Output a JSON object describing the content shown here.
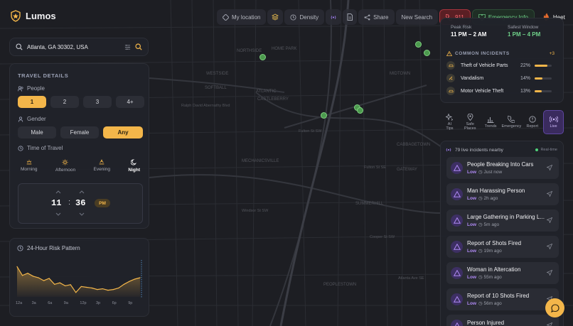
{
  "app": {
    "name": "Lumos"
  },
  "topbar": {
    "my_location": "My location",
    "density": "Density",
    "share": "Share",
    "new_search": "New Search",
    "sos": "911",
    "emergency": "Emergency Info",
    "user": "Heet"
  },
  "search": {
    "value": "Atlanta, GA 30302, USA"
  },
  "travel": {
    "title": "TRAVEL DETAILS",
    "people_label": "People",
    "people_options": [
      "1",
      "2",
      "3",
      "4+"
    ],
    "people_selected": "1",
    "gender_label": "Gender",
    "gender_options": [
      "Male",
      "Female",
      "Any"
    ],
    "gender_selected": "Any",
    "time_label": "Time of Travel",
    "time_options": [
      "Morning",
      "Afternoon",
      "Evening",
      "Night"
    ],
    "time_selected": "Night",
    "hour": "11",
    "sep": ":",
    "minute": "36",
    "ampm": "PM"
  },
  "risk_chart": {
    "title": "24-Hour Risk Pattern",
    "chart_data": {
      "type": "area",
      "title": "24-Hour Risk Pattern",
      "categories": [
        "12a",
        "3a",
        "6a",
        "9a",
        "12p",
        "3p",
        "6p",
        "9p"
      ],
      "x": [
        0,
        1,
        2,
        3,
        4,
        5,
        6,
        7,
        8,
        9,
        10,
        11,
        12,
        13,
        14,
        15,
        16,
        17,
        18,
        19,
        20,
        21,
        22,
        23
      ],
      "values": [
        82,
        58,
        64,
        56,
        52,
        44,
        50,
        34,
        38,
        30,
        33,
        12,
        28,
        26,
        24,
        20,
        22,
        18,
        20,
        24,
        34,
        42,
        48,
        52
      ],
      "ylim": [
        0,
        100
      ],
      "grid": false
    }
  },
  "summary": {
    "peak_label": "Peak Risk",
    "peak_value": "11 PM – 2 AM",
    "safe_label": "Safest Window",
    "safe_value": "1 PM – 4 PM"
  },
  "incidents": {
    "title": "COMMON INCIDENTS",
    "more": "+3",
    "items": [
      {
        "label": "Theft of Vehicle Parts",
        "pct": "22%",
        "value": 0.22
      },
      {
        "label": "Vandalism",
        "pct": "14%",
        "value": 0.14
      },
      {
        "label": "Motor Vehicle Theft",
        "pct": "13%",
        "value": 0.13
      }
    ]
  },
  "tabs": [
    {
      "label1": "AI",
      "label2": "Tips",
      "icon": "sparkle-icon"
    },
    {
      "label1": "Safe",
      "label2": "Places",
      "icon": "map-pin-icon"
    },
    {
      "label1": "Trends",
      "label2": "",
      "icon": "bar-chart-icon"
    },
    {
      "label1": "Emergency",
      "label2": "",
      "icon": "phone-icon"
    },
    {
      "label1": "Report",
      "label2": "",
      "icon": "alert-circle-icon"
    },
    {
      "label1": "Live",
      "label2": "",
      "icon": "broadcast-icon"
    }
  ],
  "feed": {
    "count_text": "79 live incidents nearby",
    "realtime": "Real-time",
    "items": [
      {
        "title": "People Breaking Into Cars",
        "level": "Low",
        "time": "Just now"
      },
      {
        "title": "Man Harassing Person",
        "level": "Low",
        "time": "2h ago"
      },
      {
        "title": "Large Gathering in Parking L...",
        "level": "Low",
        "time": "5m ago"
      },
      {
        "title": "Report of Shots Fired",
        "level": "Low",
        "time": "19m ago"
      },
      {
        "title": "Woman in Altercation",
        "level": "Low",
        "time": "55m ago"
      },
      {
        "title": "Report of 10 Shots Fired",
        "level": "Low",
        "time": "56m ago"
      },
      {
        "title": "Person Injured",
        "level": "Low",
        "time": ""
      }
    ]
  },
  "map_labels": [
    "NORTHSIDE",
    "HOME PARK",
    "ATLANTIC",
    "MIDTOWN",
    "WESTSIDE",
    "SOFTBALL",
    "CASTLEBERRY",
    "MECHANICSVILLE",
    "SUMMERHILL",
    "PEOPLESTOWN",
    "CABBAGETOWN",
    "GATEWAY",
    "Fulton St SE",
    "Fulton St SW",
    "Ralph David Abernathy Blvd",
    "Cooper St SW",
    "Windsor St SW",
    "Atlanta Ave SE"
  ]
}
